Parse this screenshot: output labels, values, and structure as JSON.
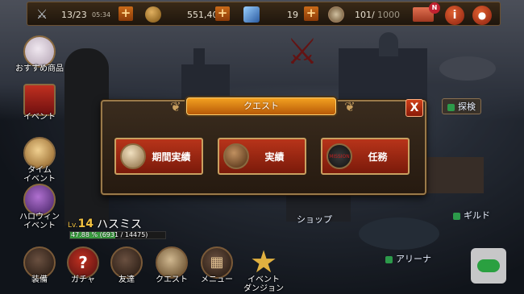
{
  "top_bar": {
    "stamina": "13/23",
    "timer": "05:34",
    "gold": "551,404",
    "gems": "19",
    "capacity_current": "101/",
    "capacity_max": "1000",
    "mail_badge": "N",
    "info_glyph": "i"
  },
  "side_menu": [
    {
      "label": "おすすめ商品",
      "icon": "rabbit-icon"
    },
    {
      "label": "イベント",
      "icon": "gift-icon"
    },
    {
      "label": "タイム\nイベント",
      "icon": "clock-icon"
    },
    {
      "label": "ハロウィン\nイベント",
      "icon": "pumpkin-icon"
    }
  ],
  "player": {
    "level_prefix": "Lv.",
    "level": "14",
    "name": "ハスミス",
    "xp": "47.88 % (6931 / 14475)",
    "xp_fraction": 0.4788
  },
  "places": {
    "explore": "探検",
    "shop": "ショップ",
    "guild": "ギルド",
    "arena": "アリーナ"
  },
  "quest_modal": {
    "title": "クエスト",
    "close": "X",
    "buttons": [
      {
        "label": "期間実績",
        "icon": "scroll-icon"
      },
      {
        "label": "実績",
        "icon": "book-icon"
      },
      {
        "label": "任務",
        "icon": "mission-badge-icon",
        "icon_text": "MISSION"
      }
    ]
  },
  "bottom_menu": [
    {
      "label": "装備"
    },
    {
      "label": "ガチャ"
    },
    {
      "label": "友達"
    },
    {
      "label": "クエスト"
    },
    {
      "label": "メニュー"
    },
    {
      "label": "イベント\nダンジョン"
    }
  ],
  "colors": {
    "accent_orange": "#f2a020",
    "button_red": "#b8341a",
    "border_gold": "#c9a060",
    "xp_green": "#3aa040"
  }
}
